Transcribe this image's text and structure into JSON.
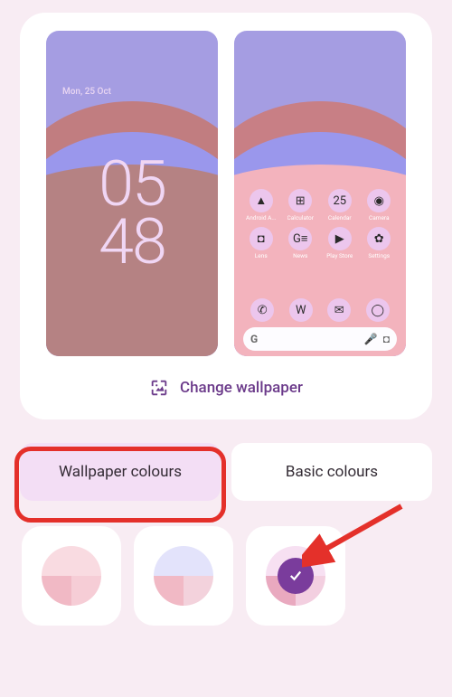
{
  "lock": {
    "date": "Mon, 25 Oct",
    "time_h": "05",
    "time_m": "48"
  },
  "home_apps": [
    {
      "label": "Android A...",
      "icon": "▲"
    },
    {
      "label": "Calculator",
      "icon": "⊞"
    },
    {
      "label": "Calendar",
      "icon": "25"
    },
    {
      "label": "Camera",
      "icon": "◉"
    },
    {
      "label": "Lens",
      "icon": "◘"
    },
    {
      "label": "News",
      "icon": "G≡"
    },
    {
      "label": "Play Store",
      "icon": "▶"
    },
    {
      "label": "Settings",
      "icon": "✿"
    }
  ],
  "dock": [
    {
      "name": "phone",
      "icon": "✆"
    },
    {
      "name": "wear",
      "icon": "W"
    },
    {
      "name": "messages",
      "icon": "✉"
    },
    {
      "name": "browser",
      "icon": "◯"
    }
  ],
  "search": {
    "logo": "G",
    "mic": "🎤",
    "lens": "◘"
  },
  "change_label": "Change wallpaper",
  "tabs": {
    "wallpaper": "Wallpaper colours",
    "basic": "Basic colours"
  },
  "swatches": [
    {
      "name": "pink",
      "c_top": "#f9dbe1",
      "c_bl": "#f1b9c5",
      "c_br": "#f6cdd6",
      "selected": false
    },
    {
      "name": "blue",
      "c_top": "#e3e3fb",
      "c_bl": "#f1b9c5",
      "c_br": "#f3d2dc",
      "selected": false
    },
    {
      "name": "purple",
      "c_top": "#f7e0f2",
      "c_bl": "#e9a9bf",
      "c_br": "#f3cfe0",
      "selected": true
    }
  ],
  "colors": {
    "accent": "#6b3a8a",
    "select_badge": "#7a3c9c"
  }
}
